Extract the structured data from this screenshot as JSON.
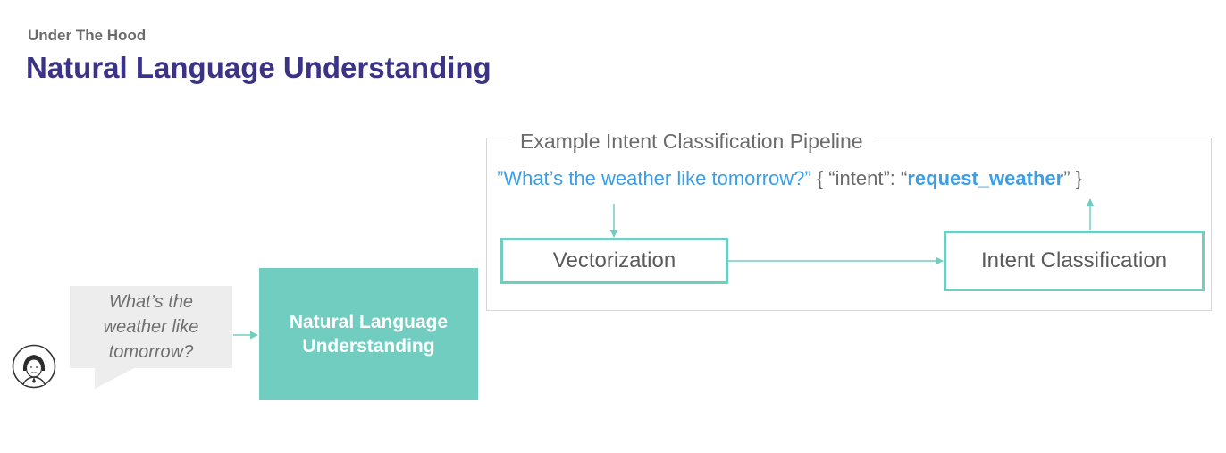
{
  "header": {
    "subtitle": "Under The Hood",
    "title": "Natural Language Understanding"
  },
  "user": {
    "icon": "user-avatar-icon",
    "bubble_text": "What’s the weather like tomorrow?"
  },
  "nlu_box": {
    "label": "Natural Language Understanding"
  },
  "pipeline": {
    "label": "Example Intent Classification Pipeline",
    "query": "”What’s the weather like tomorrow?”",
    "result_prefix": " { “intent”: “",
    "intent_value": "request_weather",
    "result_suffix": "” }",
    "stages": {
      "vectorization": "Vectorization",
      "intent_classification": "Intent Classification"
    }
  },
  "colors": {
    "title": "#3b3486",
    "teal": "#72cdc1",
    "blue": "#3a9ee8",
    "gray_text": "#6b6b6b"
  }
}
